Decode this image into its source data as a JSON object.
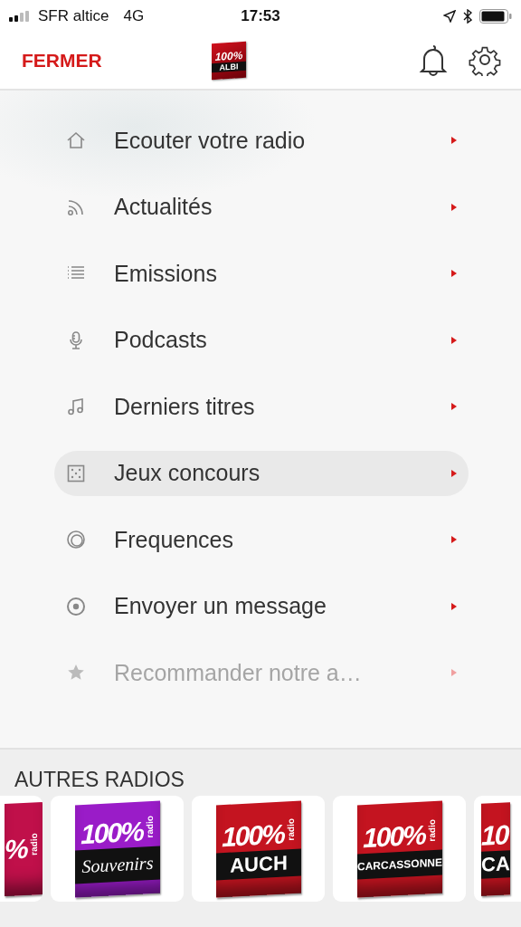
{
  "status_bar": {
    "carrier": "SFR altice",
    "network": "4G",
    "time": "17:53"
  },
  "header": {
    "close": "FERMER",
    "logo": {
      "brand": "100%",
      "name": "ALBI"
    }
  },
  "menu": [
    {
      "kind": "home",
      "label": "Ecouter votre radio",
      "selected": false,
      "disabled": false
    },
    {
      "kind": "rss",
      "label": "Actualités",
      "selected": false,
      "disabled": false
    },
    {
      "kind": "list",
      "label": "Emissions",
      "selected": false,
      "disabled": false
    },
    {
      "kind": "mic",
      "label": "Podcasts",
      "selected": false,
      "disabled": false
    },
    {
      "kind": "music",
      "label": "Derniers titres",
      "selected": false,
      "disabled": false
    },
    {
      "kind": "dice",
      "label": "Jeux concours",
      "selected": true,
      "disabled": false
    },
    {
      "kind": "waves",
      "label": "Frequences",
      "selected": false,
      "disabled": false
    },
    {
      "kind": "target",
      "label": "Envoyer un message",
      "selected": false,
      "disabled": false
    },
    {
      "kind": "star",
      "label": "Recommander notre a…",
      "selected": false,
      "disabled": true
    }
  ],
  "other_radios": {
    "title": "AUTRES RADIOS",
    "stations": [
      {
        "kind": "cut",
        "brand": "%",
        "tag": "radio",
        "color": "#c0104a"
      },
      {
        "kind": "script",
        "brand": "100%",
        "tag": "radio",
        "name": "Souvenirs",
        "color": "#9a1cc8"
      },
      {
        "kind": "block",
        "brand": "100%",
        "tag": "radio",
        "name": "AUCH",
        "color": "#c41420"
      },
      {
        "kind": "block",
        "brand": "100%",
        "tag": "radio",
        "name": "CARCASSONNE",
        "color": "#c41420"
      },
      {
        "kind": "cut",
        "brand": "10",
        "name": "CA",
        "color": "#c41420"
      }
    ]
  }
}
